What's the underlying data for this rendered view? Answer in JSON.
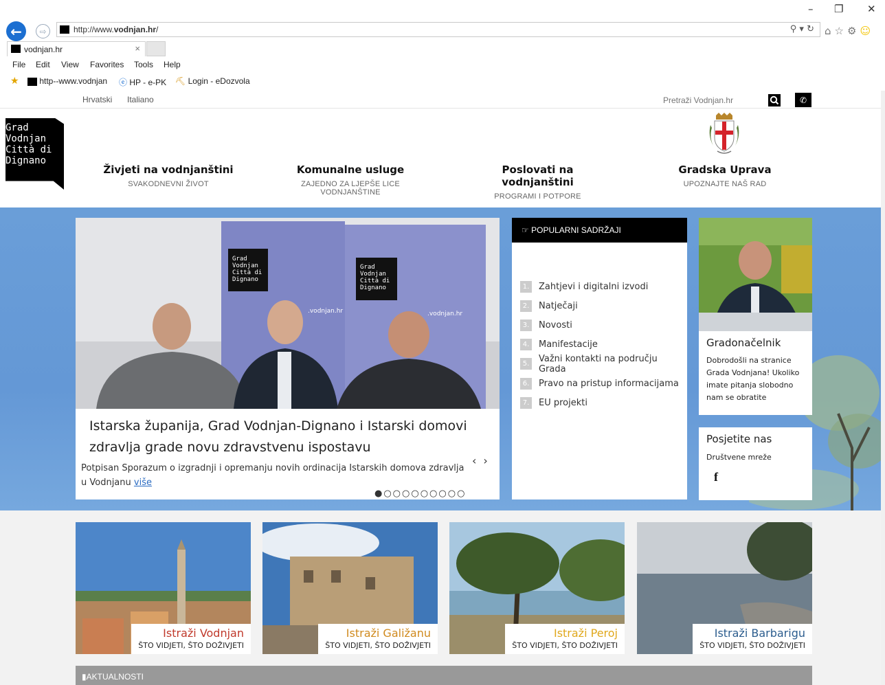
{
  "browser": {
    "url_prefix": "http://www.",
    "url_domain": "vodnjan.hr",
    "url_suffix": "/",
    "tab_title": "vodnjan.hr",
    "tab_close": "×",
    "window_min": "–",
    "window_restore": "❐",
    "window_close": "✕",
    "menu": [
      "File",
      "Edit",
      "View",
      "Favorites",
      "Tools",
      "Help"
    ],
    "favorites": [
      "http--www.vodnjan",
      "HP - e-PK",
      "Login - eDozvola"
    ]
  },
  "site": {
    "languages": [
      "Hrvatski",
      "Italiano"
    ],
    "search_placeholder": "Pretraži Vodnjan.hr",
    "logo_lines": [
      "Grad",
      "Vodnjan",
      "Città di",
      "Dignano"
    ],
    "nav": [
      {
        "title": "Živjeti na vodnjanštini",
        "sub": "SVAKODNEVNI ŽIVOT"
      },
      {
        "title": "Komunalne usluge",
        "sub": "ZAJEDNO ZA LJEPŠE LICE VODNJANŠTINE"
      },
      {
        "title": "Poslovati na vodnjanštini",
        "sub": "PROGRAMI I POTPORE"
      },
      {
        "title": "Gradska Uprava",
        "sub": "UPOZNAJTE NAŠ RAD"
      }
    ],
    "slide": {
      "title": "Istarska županija, Grad Vodnjan-Dignano i Istarski domovi zdravlja grade novu zdravstvenu ispostavu",
      "text": "Potpisan Sporazum o izgradnji i opremanju novih ordinacija Istarskih domova zdravlja u Vodnjanu",
      "more": "više",
      "banner_text_1": "Grad\nVodnjan\nCittà di\nDignano",
      "banner_url": "vodnjan.hr",
      "prev": "‹",
      "next": "›",
      "dots": "●○○○○○○○○○",
      "active_slide": 1,
      "slide_count": 10
    },
    "popular": {
      "heading": "POPULARNI SADRŽAJI",
      "items": [
        {
          "num": "1.",
          "label": "Zahtjevi i digitalni izvodi"
        },
        {
          "num": "2.",
          "label": "Natječaji"
        },
        {
          "num": "3.",
          "label": "Novosti"
        },
        {
          "num": "4.",
          "label": "Manifestacije"
        },
        {
          "num": "5.",
          "label": "Važni kontakti na području Grada"
        },
        {
          "num": "6.",
          "label": "Pravo na pristup informacijama"
        },
        {
          "num": "7.",
          "label": "EU projekti"
        }
      ]
    },
    "mayor": {
      "heading": "Gradonačelnik",
      "text": "Dobrodošli na stranice Grada Vodnjana! Ukoliko imate pitanja slobodno nam se obratite"
    },
    "visit": {
      "heading": "Posjetite nas",
      "sub": "Društvene mreže",
      "fb": "f"
    },
    "tiles": [
      {
        "name": "Istraži Vodnjan",
        "sub": "ŠTO VIDJETI, ŠTO DOŽIVJETI",
        "color": "#c0392b"
      },
      {
        "name": "Istraži Galižanu",
        "sub": "ŠTO VIDJETI, ŠTO DOŽIVJETI",
        "color": "#d08a1e"
      },
      {
        "name": "Istraži Peroj",
        "sub": "ŠTO VIDJETI, ŠTO DOŽIVJETI",
        "color": "#e0a81c"
      },
      {
        "name": "Istraži Barbarigu",
        "sub": "ŠTO VIDJETI, ŠTO DOŽIVJETI",
        "color": "#2c5d8e"
      }
    ],
    "news_heading": "AKTUALNOSTI"
  },
  "colors": {
    "browser_blue": "#1c6fd1",
    "hero_blue": "#6a9ed8",
    "link": "#2a6bc2"
  }
}
